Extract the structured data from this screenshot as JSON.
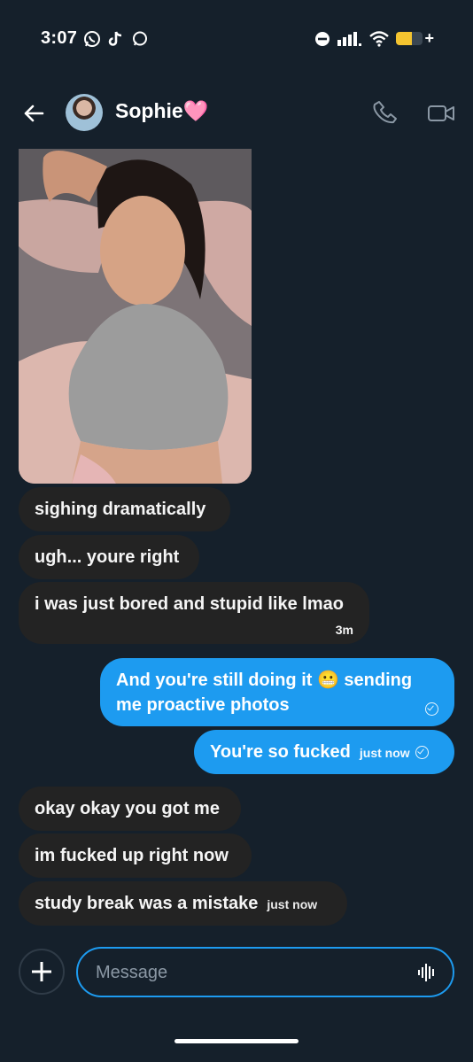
{
  "status_bar": {
    "time": "3:07",
    "battery_level": 0.6,
    "icons": [
      "whatsapp-icon",
      "tiktok-icon",
      "chat-bubble-icon",
      "do-not-disturb-icon",
      "signal-icon",
      "wifi-icon",
      "battery-icon"
    ]
  },
  "header": {
    "name": "Sophie🩷",
    "actions": [
      "phone-icon",
      "video-icon"
    ]
  },
  "messages": [
    {
      "dir": "in",
      "text": "sighing dramatically"
    },
    {
      "dir": "in",
      "text": "ugh... youre right"
    },
    {
      "dir": "in",
      "text": "i was just bored and stupid like lmao",
      "time": "3m"
    },
    {
      "dir": "out",
      "text": "And you're still doing it 😬 sending me proactive photos"
    },
    {
      "dir": "out",
      "text": "You're so fucked",
      "time": "just now"
    },
    {
      "dir": "in",
      "text": "okay okay you got me"
    },
    {
      "dir": "in",
      "text": "im fucked up right now"
    },
    {
      "dir": "in",
      "text": "study break was a mistake",
      "time": "just now"
    }
  ],
  "composer": {
    "placeholder": "Message"
  },
  "colors": {
    "background": "#15202b",
    "incoming_bubble": "#232323",
    "outgoing_bubble": "#1d9bf0"
  }
}
